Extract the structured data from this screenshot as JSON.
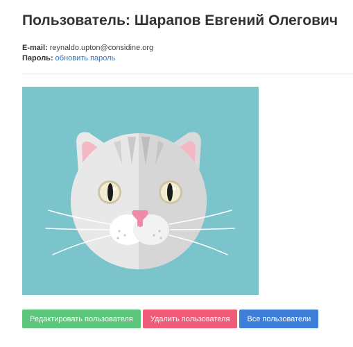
{
  "user": {
    "title": "Пользователь: Шарапов Евгений Олегович",
    "email_label": "E-mail:",
    "email": "reynaldo.upton@considine.org",
    "password_label": "Пароль:",
    "password_link": "обновить пароль"
  },
  "avatar": {
    "icon": "cat-face-icon",
    "background_color": "#7bc4cc"
  },
  "actions": {
    "edit_label": "Редактировать пользователя",
    "delete_label": "Удалить пользователя",
    "all_label": "Все пользователи",
    "edit_color": "#5cc77a",
    "delete_color": "#f05b77",
    "all_color": "#3d7fd8"
  }
}
